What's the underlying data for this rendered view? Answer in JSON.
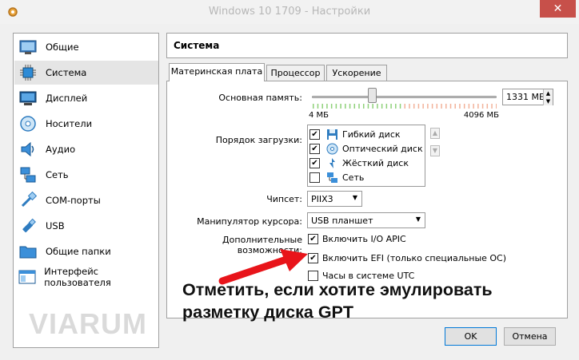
{
  "window": {
    "title": "Windows 10 1709 - Настройки",
    "close_glyph": "✕"
  },
  "sidebar": {
    "items": [
      {
        "label": "Общие",
        "icon": "general-icon"
      },
      {
        "label": "Система",
        "icon": "chip-icon"
      },
      {
        "label": "Дисплей",
        "icon": "monitor-icon"
      },
      {
        "label": "Носители",
        "icon": "disc-icon"
      },
      {
        "label": "Аудио",
        "icon": "speaker-icon"
      },
      {
        "label": "Сеть",
        "icon": "network-icon"
      },
      {
        "label": "COM-порты",
        "icon": "serial-port-icon"
      },
      {
        "label": "USB",
        "icon": "usb-icon"
      },
      {
        "label": "Общие папки",
        "icon": "folder-icon"
      },
      {
        "label": "Интерфейс пользователя",
        "icon": "ui-icon"
      }
    ],
    "active_index": 1
  },
  "header": {
    "title": "Система"
  },
  "tabs": [
    {
      "label": "Материнская плата",
      "active": true
    },
    {
      "label": "Процессор",
      "active": false
    },
    {
      "label": "Ускорение",
      "active": false
    }
  ],
  "motherboard": {
    "memory": {
      "label": "Основная память:",
      "value": "1331 МБ",
      "min_label": "4 МБ",
      "max_label": "4096 МБ",
      "fraction": 0.325
    },
    "boot_order": {
      "label": "Порядок загрузки:",
      "items": [
        {
          "label": "Гибкий диск",
          "checked": true,
          "icon": "floppy-icon"
        },
        {
          "label": "Оптический диск",
          "checked": true,
          "icon": "optical-disc-icon"
        },
        {
          "label": "Жёсткий диск",
          "checked": true,
          "icon": "hard-disk-icon"
        },
        {
          "label": "Сеть",
          "checked": false,
          "icon": "network-icon"
        }
      ],
      "up_glyph": "▲",
      "down_glyph": "▼"
    },
    "chipset": {
      "label": "Чипсет:",
      "value": "PIIX3"
    },
    "pointing": {
      "label": "Манипулятор курсора:",
      "value": "USB планшет"
    },
    "extended": {
      "label": "Дополнительные возможности:",
      "options": [
        {
          "label": "Включить I/O APIC",
          "checked": true
        },
        {
          "label": "Включить EFI (только специальные ОС)",
          "checked": true
        },
        {
          "label": "Часы в системе UTC",
          "checked": false
        }
      ]
    }
  },
  "annotation": {
    "line1": "Отметить, если хотите эмулировать",
    "line2": "разметку диска GPT",
    "arrow_color": "#e8141a"
  },
  "watermark": {
    "text": "VIARUM"
  },
  "buttons": {
    "ok": "OK",
    "cancel": "Отмена"
  },
  "colors": {
    "close_bg": "#c7504a",
    "active_item_bg": "#e5e5e5",
    "slider_green": "#8fd17a",
    "slider_orange": "#f2b29a"
  }
}
